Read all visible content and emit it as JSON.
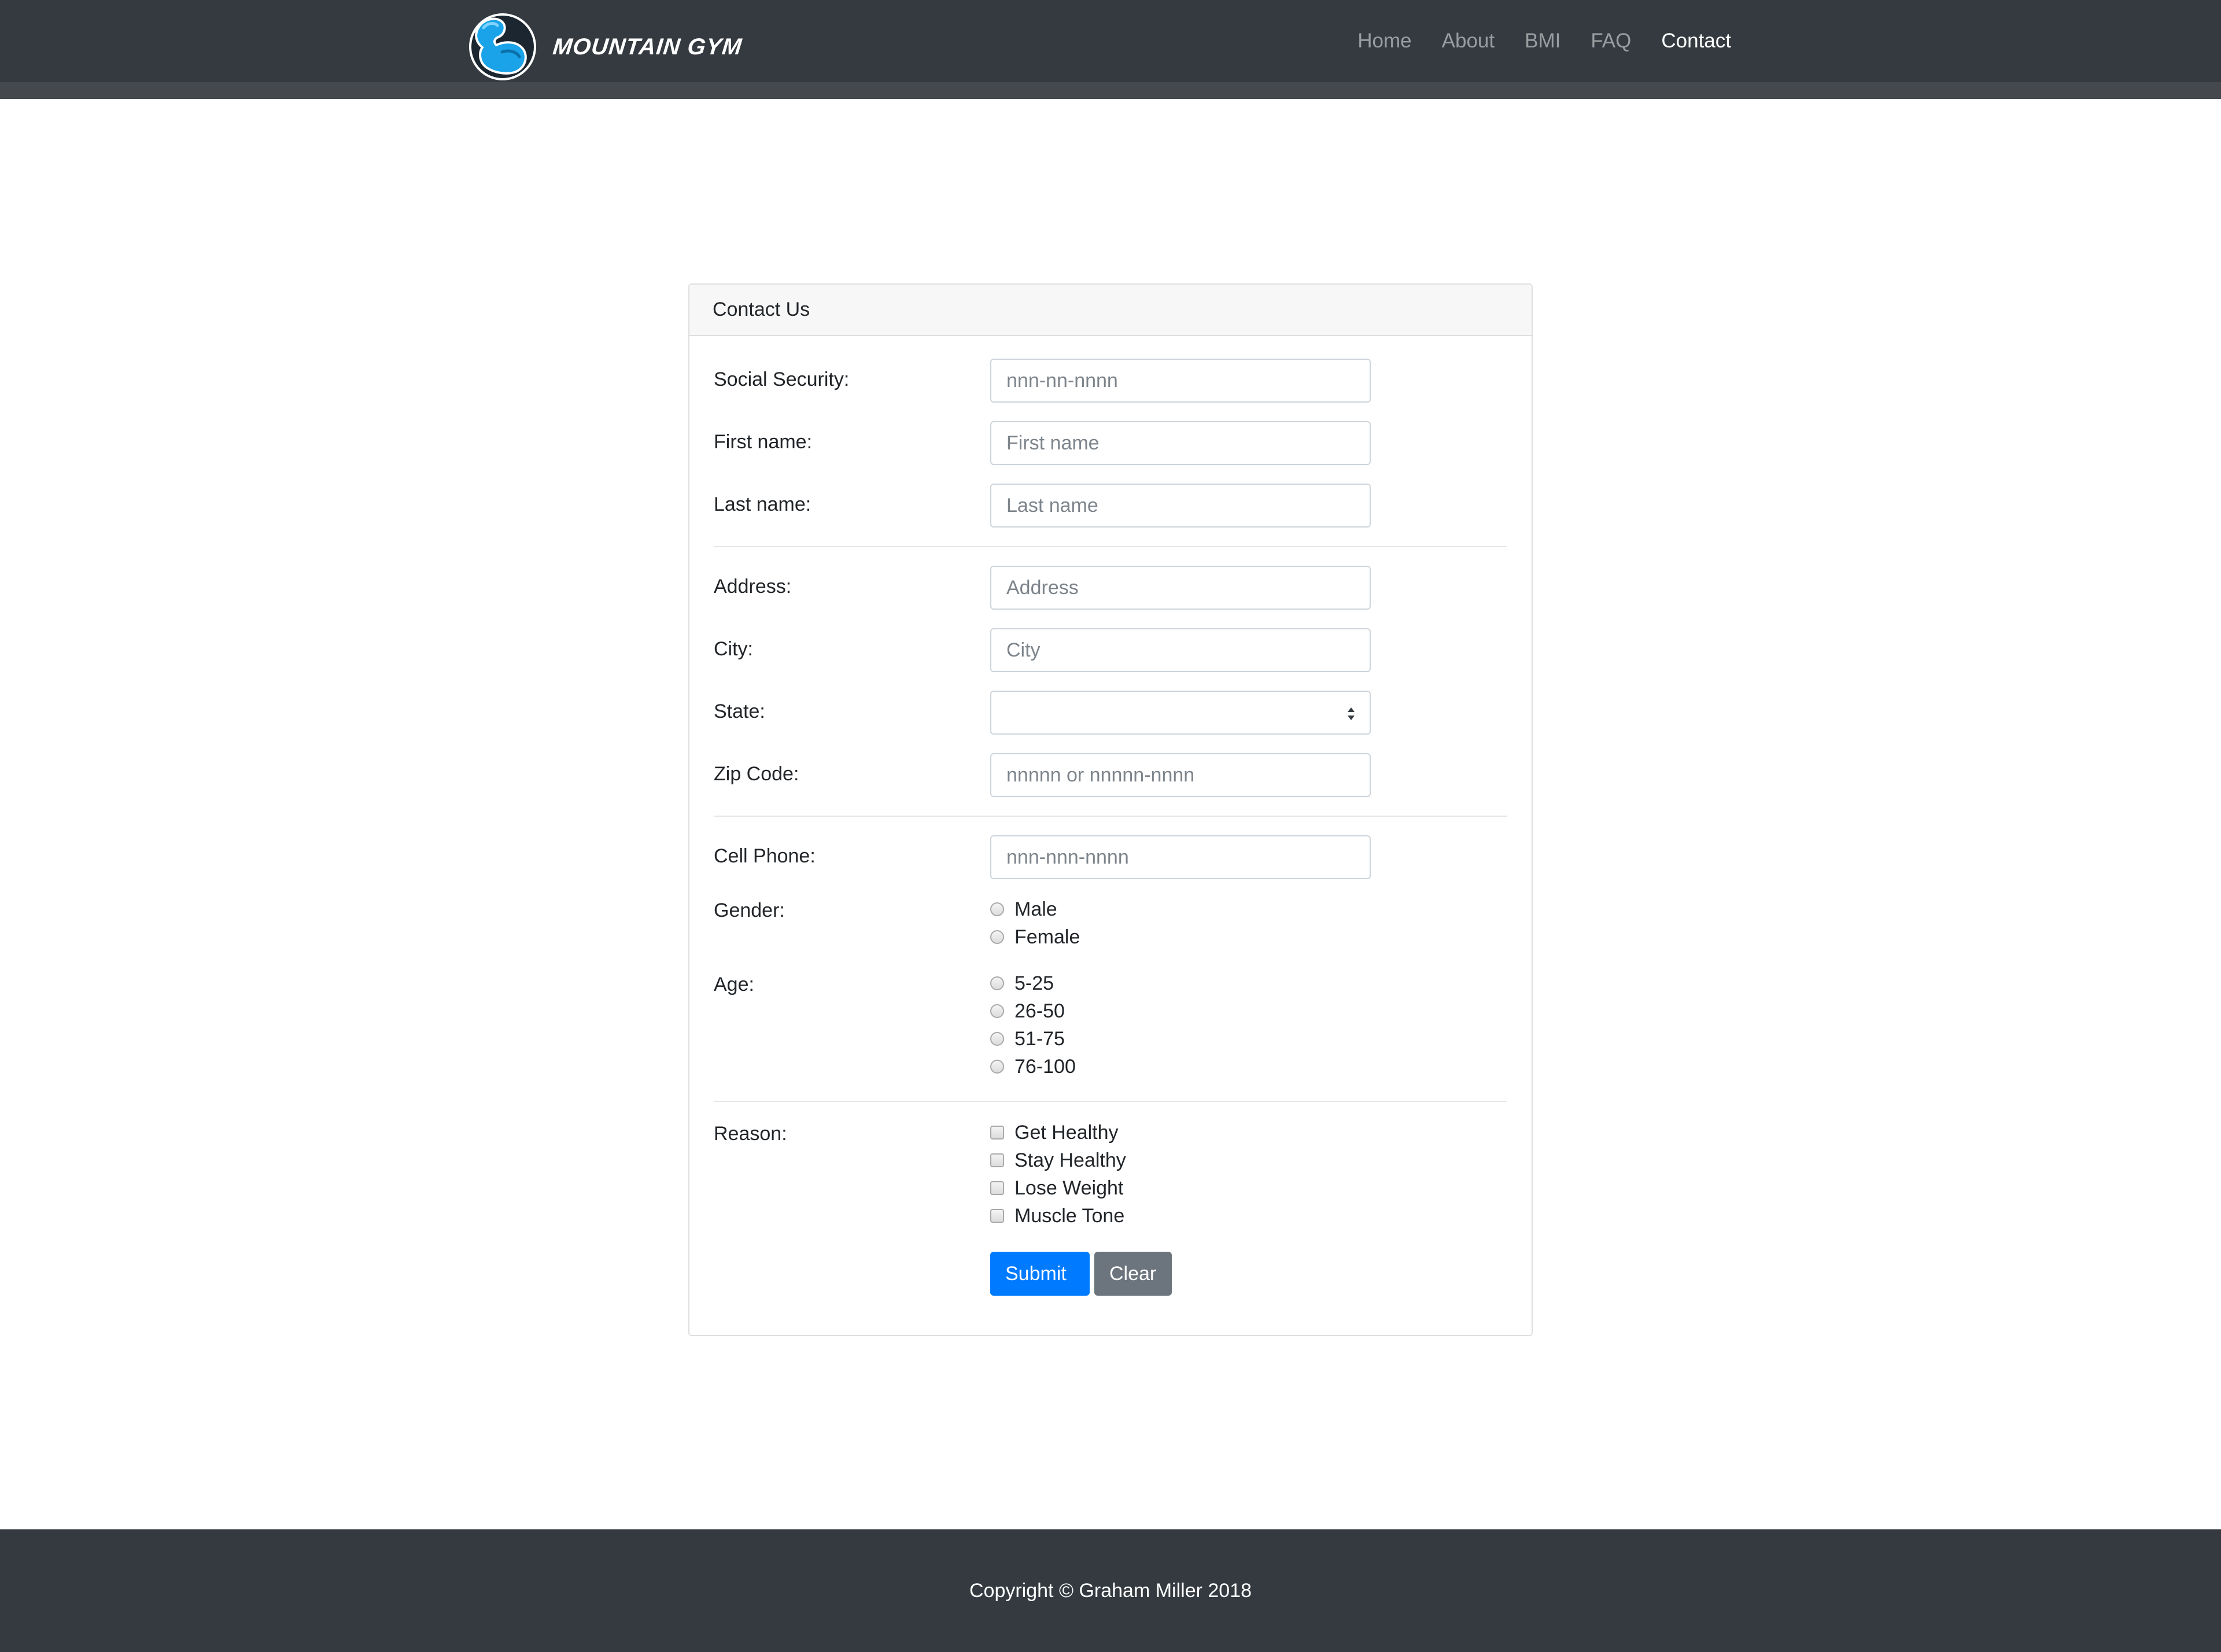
{
  "brand": {
    "name": "MOUNTAIN GYM",
    "logo_icon": "flexed-arm-icon",
    "accent": "#1aa3e8"
  },
  "nav": {
    "items": [
      {
        "label": "Home",
        "active": false
      },
      {
        "label": "About",
        "active": false
      },
      {
        "label": "BMI",
        "active": false
      },
      {
        "label": "FAQ",
        "active": false
      },
      {
        "label": "Contact",
        "active": true
      }
    ]
  },
  "form": {
    "title": "Contact Us",
    "ssn": {
      "label": "Social Security:",
      "placeholder": "nnn-nn-nnnn",
      "value": ""
    },
    "first_name": {
      "label": "First name:",
      "placeholder": "First name",
      "value": ""
    },
    "last_name": {
      "label": "Last name:",
      "placeholder": "Last name",
      "value": ""
    },
    "address": {
      "label": "Address:",
      "placeholder": "Address",
      "value": ""
    },
    "city": {
      "label": "City:",
      "placeholder": "City",
      "value": ""
    },
    "state": {
      "label": "State:",
      "value": ""
    },
    "zip": {
      "label": "Zip Code:",
      "placeholder": "nnnnn or nnnnn-nnnn",
      "value": ""
    },
    "cell": {
      "label": "Cell Phone:",
      "placeholder": "nnn-nnn-nnnn",
      "value": ""
    },
    "gender": {
      "label": "Gender:",
      "options": [
        "Male",
        "Female"
      ]
    },
    "age": {
      "label": "Age:",
      "options": [
        "5-25",
        "26-50",
        "51-75",
        "76-100"
      ]
    },
    "reason": {
      "label": "Reason:",
      "options": [
        "Get Healthy",
        "Stay Healthy",
        "Lose Weight",
        "Muscle Tone"
      ]
    },
    "submit_label": "Submit",
    "clear_label": "Clear",
    "colors": {
      "primary": "#007bff",
      "secondary": "#6c757d"
    }
  },
  "footer": {
    "text": "Copyright © Graham Miller 2018"
  }
}
